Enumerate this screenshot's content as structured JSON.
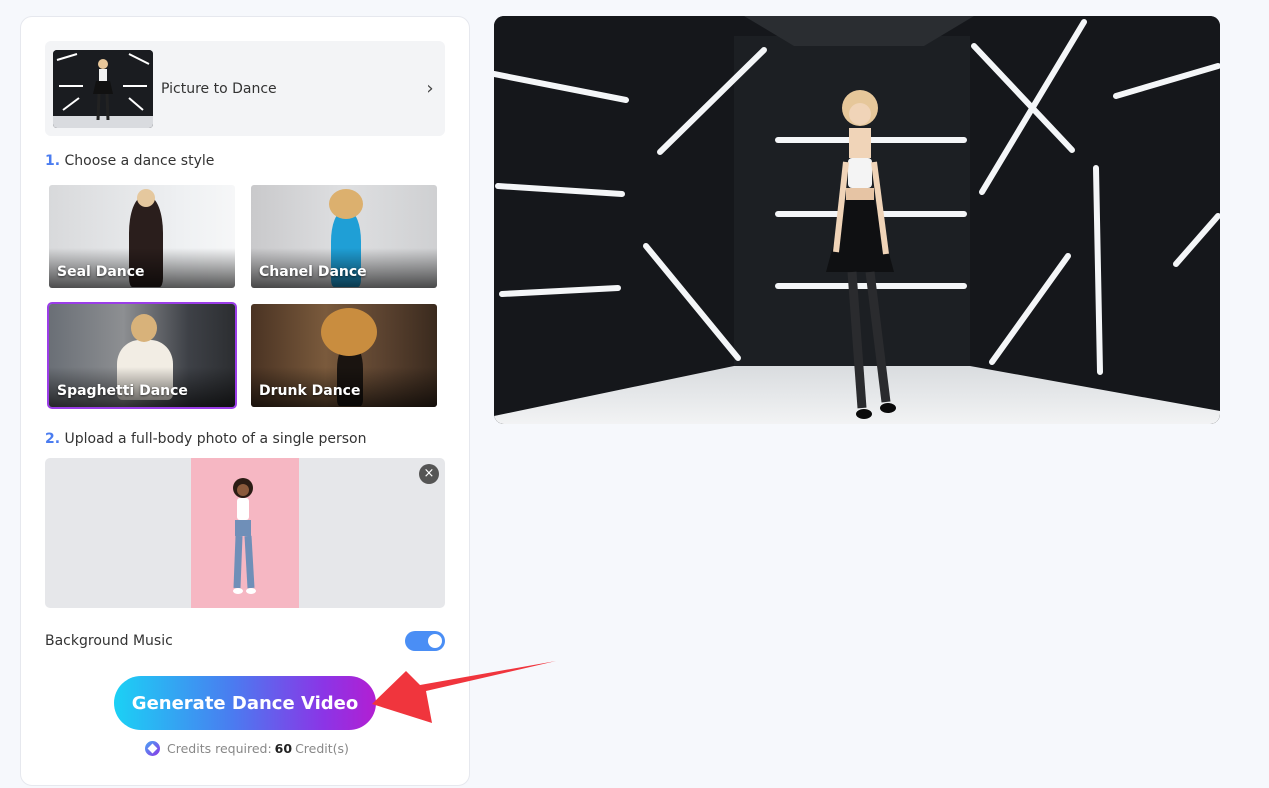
{
  "tool": {
    "title": "Picture to Dance",
    "chevron": "›",
    "thumb_icon": "dancer-thumbnail"
  },
  "steps": {
    "one": {
      "num": "1.",
      "label": "Choose a dance style"
    },
    "two": {
      "num": "2.",
      "label": "Upload a full-body photo of a single person"
    }
  },
  "styles": [
    {
      "name": "Seal Dance",
      "selected": false
    },
    {
      "name": "Chanel Dance",
      "selected": false
    },
    {
      "name": "Spaghetti Dance",
      "selected": true
    },
    {
      "name": "Drunk Dance",
      "selected": false
    }
  ],
  "upload": {
    "close": "×",
    "background_color": "#f6b7c3"
  },
  "music": {
    "label": "Background Music",
    "enabled": true
  },
  "generate": {
    "label": "Generate Dance Video"
  },
  "credits": {
    "prefix": "Credits required:",
    "amount": "60",
    "suffix": "Credit(s)"
  },
  "colors": {
    "accent": "#4a7cf0",
    "selected_border": "#9b3de8",
    "toggle_on": "#4a8ef5",
    "annotation_arrow": "#f0353d"
  }
}
